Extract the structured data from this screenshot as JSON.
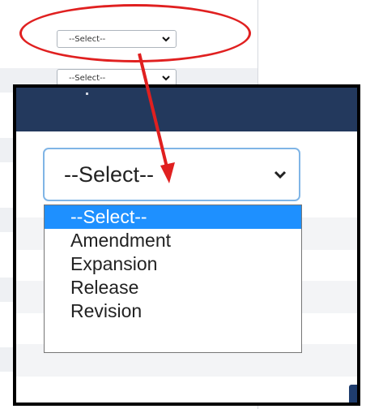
{
  "background_form": {
    "select_1": {
      "value": "--Select--"
    },
    "select_2": {
      "value": "--Select--"
    }
  },
  "zoomed_dropdown": {
    "current_value": "--Select--",
    "options": [
      "--Select--",
      "Amendment",
      "Expansion",
      "Release",
      "Revision"
    ],
    "highlighted_option": "--Select--"
  },
  "colors": {
    "callout": "#e02020",
    "option_highlight": "#1e90ff",
    "header": "#23395d",
    "focus_border": "#80b5e6"
  },
  "icons": {
    "select_arrow": "chevron-down-icon"
  }
}
